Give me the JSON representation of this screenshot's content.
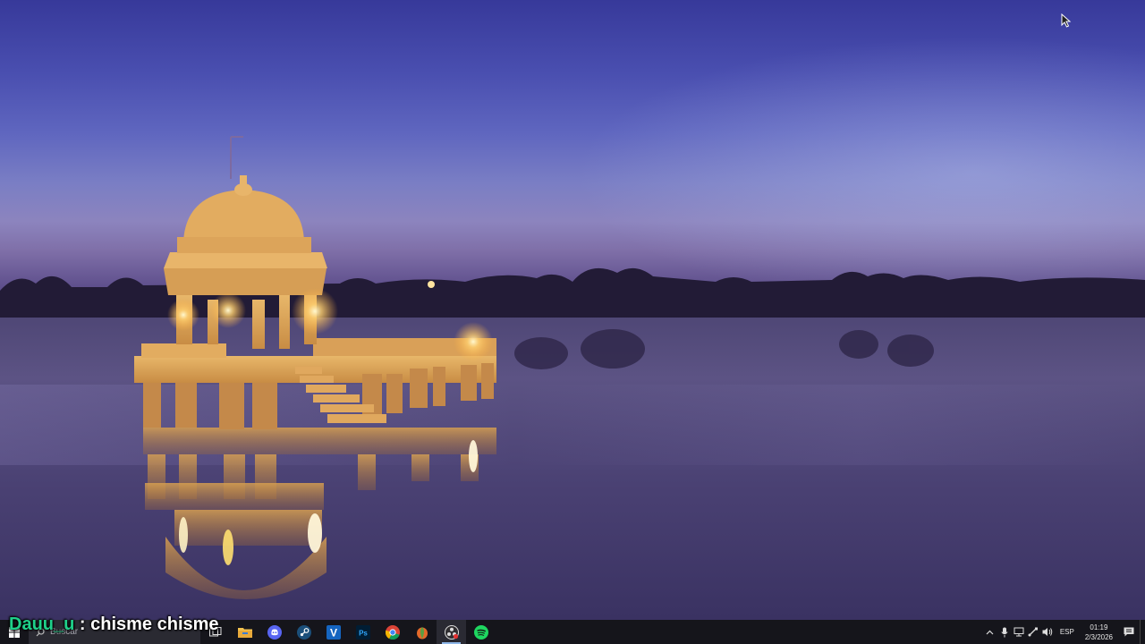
{
  "chat": {
    "username": "Dauu_u",
    "separator": " : ",
    "message": "chisme chisme"
  },
  "taskbar": {
    "search_placeholder": "Buscar",
    "pinned": [
      {
        "name": "task-view-icon"
      },
      {
        "name": "file-explorer-icon"
      },
      {
        "name": "discord-icon"
      },
      {
        "name": "steam-icon"
      },
      {
        "name": "v-app-icon",
        "glyph": "V"
      },
      {
        "name": "photoshop-icon",
        "glyph": "Ps"
      },
      {
        "name": "chrome-icon"
      },
      {
        "name": "app-icon"
      },
      {
        "name": "obs-icon",
        "active": true
      },
      {
        "name": "spotify-icon"
      }
    ],
    "tray": {
      "language": "ESP",
      "time": "01:19",
      "date": "2/3/2026"
    }
  },
  "colors": {
    "taskbar_bg": "#15151b",
    "chat_username": "#1fd08a",
    "accent": "#8fb7e8"
  }
}
